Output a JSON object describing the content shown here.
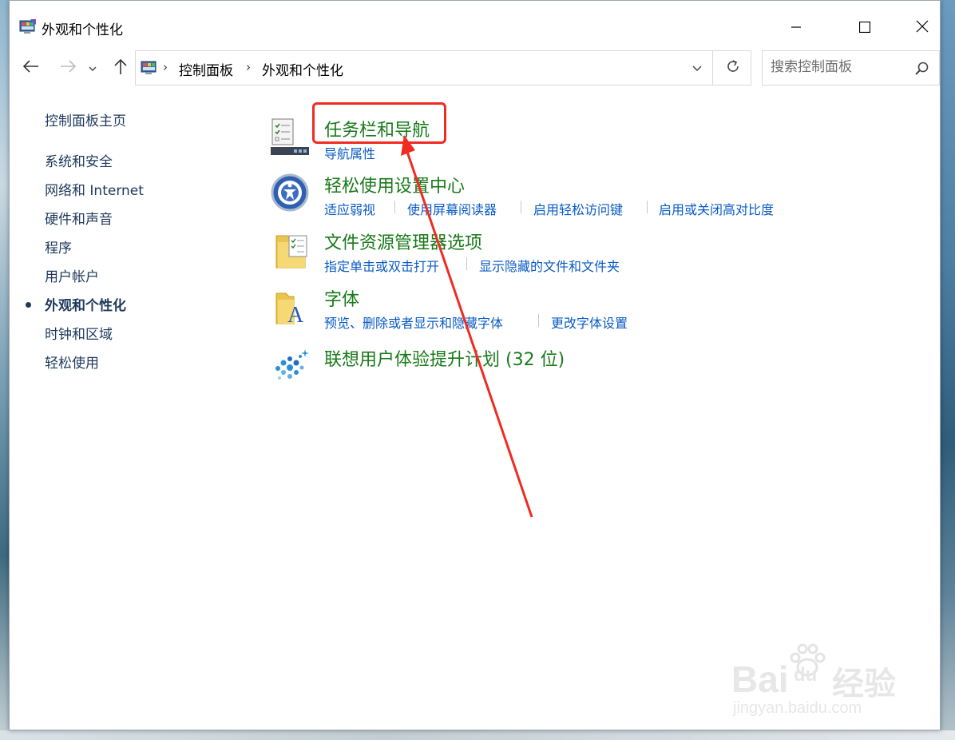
{
  "window": {
    "title": "外观和个性化",
    "icon": "control-panel-icon",
    "controls": [
      "minimize-icon",
      "maximize-icon",
      "close-icon"
    ]
  },
  "nav": {
    "back_icon": "arrow-left-icon",
    "forward_icon": "arrow-right-icon",
    "recent_icon": "chevron-down-icon",
    "up_icon": "arrow-up-icon",
    "breadcrumb": [
      "控制面板",
      "外观和个性化"
    ],
    "refresh_icon": "refresh-icon",
    "search_placeholder": "搜索控制面板"
  },
  "sidebar": {
    "items": [
      {
        "label": "控制面板主页",
        "active": false
      },
      {
        "label": "系统和安全",
        "active": false
      },
      {
        "label": "网络和 Internet",
        "active": false
      },
      {
        "label": "硬件和声音",
        "active": false
      },
      {
        "label": "程序",
        "active": false
      },
      {
        "label": "用户帐户",
        "active": false
      },
      {
        "label": "外观和个性化",
        "active": true
      },
      {
        "label": "时钟和区域",
        "active": false
      },
      {
        "label": "轻松使用",
        "active": false
      }
    ]
  },
  "categories": [
    {
      "title": "任务栏和导航",
      "icon": "taskbar-icon",
      "links": [
        "导航属性"
      ]
    },
    {
      "title": "轻松使用设置中心",
      "icon": "ease-of-access-icon",
      "links": [
        "适应弱视",
        "使用屏幕阅读器",
        "启用轻松访问键",
        "启用或关闭高对比度"
      ]
    },
    {
      "title": "文件资源管理器选项",
      "icon": "folder-options-icon",
      "links": [
        "指定单击或双击打开",
        "显示隐藏的文件和文件夹"
      ]
    },
    {
      "title": "字体",
      "icon": "fonts-folder-icon",
      "links": [
        "预览、删除或者显示和隐藏字体",
        "更改字体设置"
      ]
    },
    {
      "title": "联想用户体验提升计划 (32 位)",
      "icon": "lenovo-program-icon",
      "links": []
    }
  ],
  "annotation": {
    "color": "#ef2b22"
  },
  "watermark": {
    "text": "Bai",
    "text2": "du",
    "brand_cn": "经验",
    "url": "jingyan.baidu.com"
  },
  "colors": {
    "title_green": "#1a7a1a",
    "link_blue": "#0a5bc4",
    "sidebar_text": "#1e395b"
  }
}
